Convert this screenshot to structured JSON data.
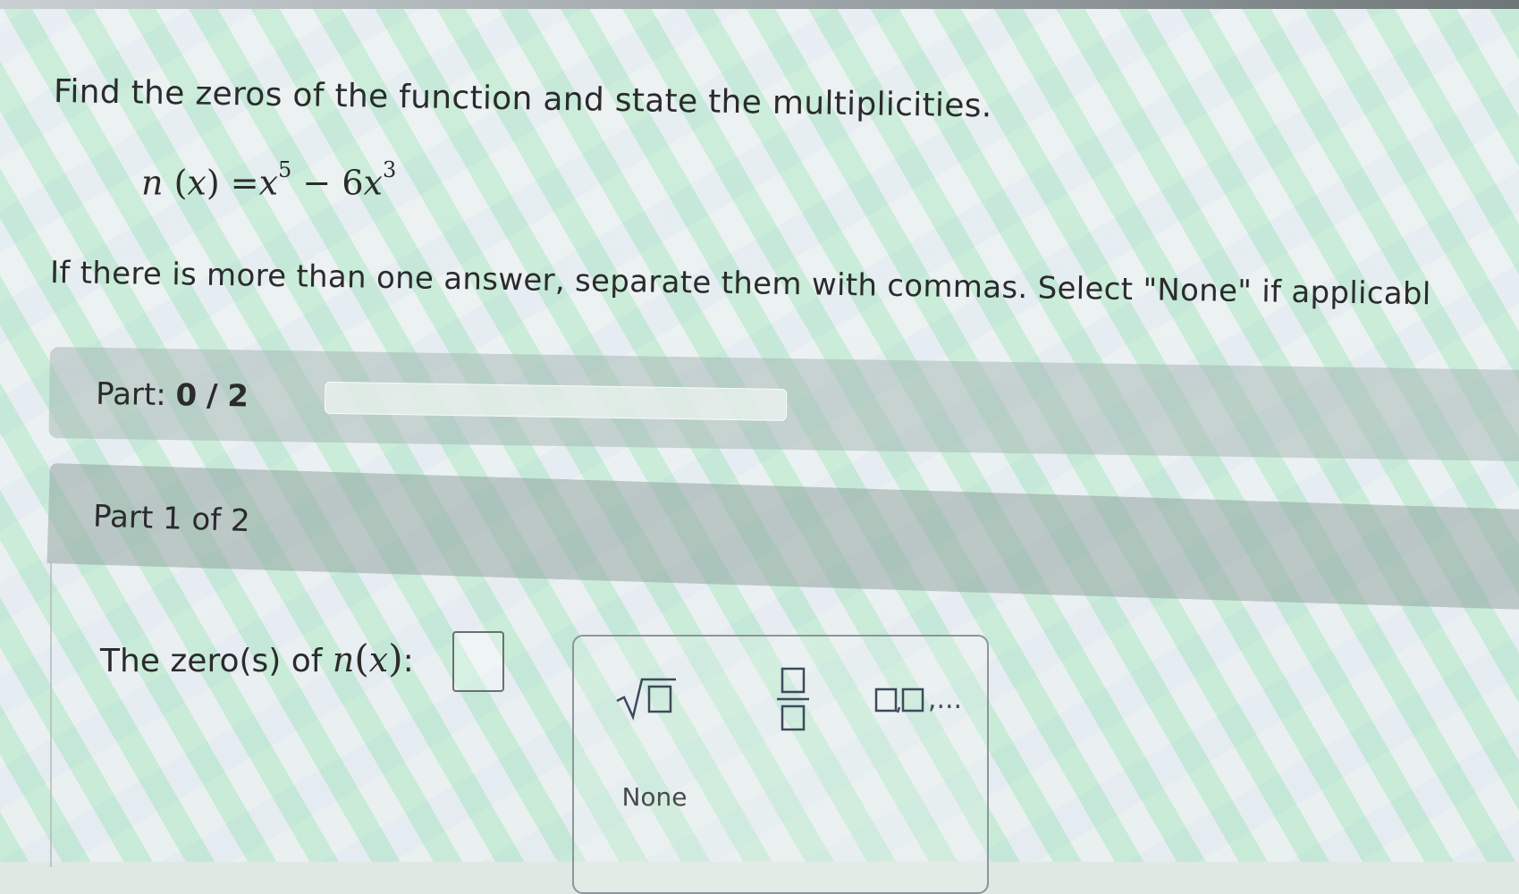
{
  "question": {
    "prompt": "Find the zeros of the function and state the multiplicities.",
    "function_name": "n",
    "function_var": "x",
    "term1_base": "x",
    "term1_exp": "5",
    "operator": "−",
    "term2_coef": "6",
    "term2_base": "x",
    "term2_exp": "3",
    "instruction": "If there is more than one answer, separate them with commas. Select \"None\" if applicabl"
  },
  "progress": {
    "label": "Part:",
    "current": "0",
    "separator": "/",
    "total": "2",
    "fraction": 0.0
  },
  "part": {
    "header": "Part 1 of 2",
    "zero_prompt_prefix": "The zero(s) of",
    "zero_prompt_func": "n",
    "zero_prompt_var": "x",
    "zero_prompt_suffix": ":",
    "answer_value": ""
  },
  "keypad": {
    "sqrt_icon": "sqrt-icon",
    "fraction_icon": "fraction-icon",
    "list_icon": "list-icon",
    "list_suffix": ",...",
    "none_label": "None"
  },
  "colors": {
    "text": "#2b2b2b",
    "keypad_icon": "#3d4a5c",
    "input_border": "#6a6f72"
  }
}
